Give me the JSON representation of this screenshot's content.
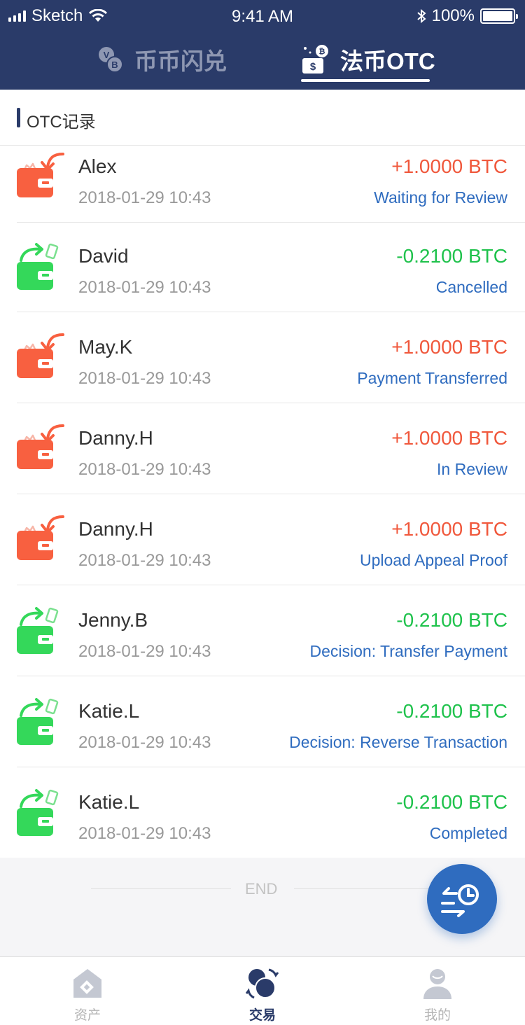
{
  "status_bar": {
    "carrier": "Sketch",
    "time": "9:41 AM",
    "battery": "100%"
  },
  "top_tabs": [
    {
      "label": "币币闪兑",
      "active": false,
      "icon": "coin-swap-icon"
    },
    {
      "label": "法币OTC",
      "active": true,
      "icon": "cash-coin-icon"
    }
  ],
  "section": {
    "title": "OTC记录"
  },
  "colors": {
    "header": "#2a3b69",
    "incoming": "#f0583c",
    "outgoing": "#1fc24c",
    "status": "#2f6cbf"
  },
  "records": [
    {
      "name": "Alex",
      "time": "2018-01-29 10:43",
      "amount": "+1.0000 BTC",
      "status": "Waiting for Review",
      "direction": "in"
    },
    {
      "name": "David",
      "time": "2018-01-29 10:43",
      "amount": "-0.2100 BTC",
      "status": "Cancelled",
      "direction": "out"
    },
    {
      "name": "May.K",
      "time": "2018-01-29 10:43",
      "amount": "+1.0000 BTC",
      "status": "Payment Transferred",
      "direction": "in"
    },
    {
      "name": "Danny.H",
      "time": "2018-01-29 10:43",
      "amount": "+1.0000 BTC",
      "status": "In Review",
      "direction": "in"
    },
    {
      "name": "Danny.H",
      "time": "2018-01-29 10:43",
      "amount": "+1.0000 BTC",
      "status": "Upload Appeal Proof",
      "direction": "in"
    },
    {
      "name": "Jenny.B",
      "time": "2018-01-29 10:43",
      "amount": "-0.2100 BTC",
      "status": "Decision: Transfer Payment",
      "direction": "out"
    },
    {
      "name": "Katie.L",
      "time": "2018-01-29 10:43",
      "amount": "-0.2100 BTC",
      "status": "Decision: Reverse Transaction",
      "direction": "out"
    },
    {
      "name": "Katie.L",
      "time": "2018-01-29 10:43",
      "amount": "-0.2100 BTC",
      "status": "Completed",
      "direction": "out"
    }
  ],
  "end_text": "END",
  "bottom_tabs": [
    {
      "label": "资产",
      "active": false,
      "icon": "assets-icon"
    },
    {
      "label": "交易",
      "active": true,
      "icon": "trade-icon"
    },
    {
      "label": "我的",
      "active": false,
      "icon": "profile-icon"
    }
  ]
}
